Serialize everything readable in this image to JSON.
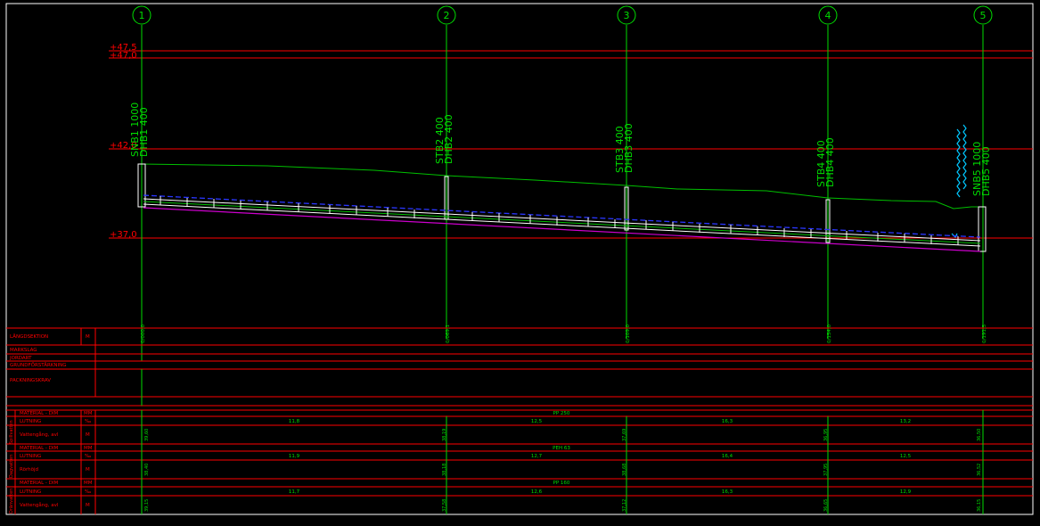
{
  "colors": {
    "frame": "#ffffff",
    "grid": "#ff0000",
    "stations": "#00dd00",
    "terrain": "#00c000",
    "pipe": "#ffffff",
    "dashed": "#2a36ff",
    "bottom": "#cc00cc",
    "accent": "#00c8ff"
  },
  "stations": [
    {
      "num": "1",
      "chainage": "0/000,0",
      "labels": [
        "SNB1 1000",
        "DHB1 400"
      ]
    },
    {
      "num": "2",
      "chainage": "0/069,1",
      "labels": [
        "STB2 400",
        "DHB2 400"
      ]
    },
    {
      "num": "3",
      "chainage": "0/109,0",
      "labels": [
        "STB3 400",
        "DHB3 400"
      ]
    },
    {
      "num": "4",
      "chainage": "0/154,0",
      "labels": [
        "STB4 400",
        "DHB4 400"
      ]
    },
    {
      "num": "5",
      "chainage": "0/191,5",
      "labels": [
        "SNB5 1000",
        "DHB5 400"
      ]
    }
  ],
  "levels": [
    "+47,5",
    "+47,0",
    "+42,0",
    "+37,0"
  ],
  "row_labels": {
    "langdsektion": "LÄNGDSEKTION",
    "langdsektion_unit": "M",
    "markslag": "MARKSLAG",
    "jordart": "JORDART",
    "grundforstarkning": "GRUNDFÖRSTÄRKNING",
    "packningskrav": "PACKNINGSKRAV"
  },
  "sections": [
    {
      "side": "Spillvatten",
      "material_label": "MATERIAL - DIM",
      "material_unit": "MM",
      "material_value": "PP 250",
      "lutning_label": "LUTNING",
      "lutning_unit": "‰",
      "slopes": [
        "11,8",
        "12,5",
        "16,3",
        "13,2"
      ],
      "level_label": "Vattengång, avl",
      "level_unit": "M",
      "levels": [
        "39,60",
        "38,19",
        "37,69",
        "36,95",
        "36,50"
      ]
    },
    {
      "side": "Dagvatten",
      "material_label": "MATERIAL - DIM",
      "material_unit": "MM",
      "material_value": "PEH 63",
      "lutning_label": "LUTNING",
      "lutning_unit": "‰",
      "slopes": [
        "11,9",
        "12,7",
        "16,4",
        "12,5"
      ],
      "level_label": "Rörhöjd",
      "level_unit": "M",
      "levels": [
        "38,40",
        "38,18",
        "38,68",
        "37,95",
        "36,52"
      ]
    },
    {
      "side": "Dränvatten",
      "material_label": "MATERIAL - DIM",
      "material_unit": "MM",
      "material_value": "PP 160",
      "lutning_label": "LUTNING",
      "lutning_unit": "‰",
      "slopes": [
        "11,7",
        "12,6",
        "16,3",
        "12,9"
      ],
      "level_label": "Vattengång, avl",
      "level_unit": "M",
      "levels": [
        "39,15",
        "37,58",
        "37,12",
        "36,65",
        "36,15"
      ]
    }
  ]
}
